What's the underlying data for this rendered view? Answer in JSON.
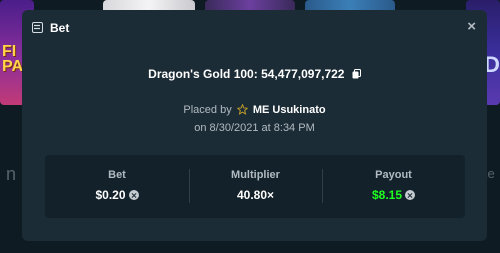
{
  "background": {
    "left_tile_text": "FI PA",
    "right_tile_text": "D",
    "left_side_glyph": "n",
    "right_side_glyph": "ke"
  },
  "modal": {
    "title": "Bet",
    "close_label": "×",
    "game": {
      "name": "Dragon's Gold 100",
      "separator": ": ",
      "bet_id": "54,477,097,722"
    },
    "placed": {
      "prefix": "Placed by",
      "user": "ME Usukinato",
      "date_line": "on 8/30/2021 at 8:34 PM"
    },
    "stats": [
      {
        "label": "Bet",
        "value": "$0.20",
        "value_color": "#ffffff",
        "currency_icon": "currency-icon"
      },
      {
        "label": "Multiplier",
        "value": "40.80×",
        "value_color": "#ffffff"
      },
      {
        "label": "Payout",
        "value": "$8.15",
        "value_color": "#1fff20",
        "currency_icon": "currency-icon"
      }
    ]
  },
  "icons": {
    "bet": "bet-ticket-icon",
    "close": "close-icon",
    "copy": "copy-icon",
    "user_rank": "star-icon"
  },
  "colors": {
    "modal_bg": "#1c2c36",
    "stats_bg": "#13212a",
    "payout_green": "#1fff20",
    "muted_text": "#b1bac1"
  }
}
